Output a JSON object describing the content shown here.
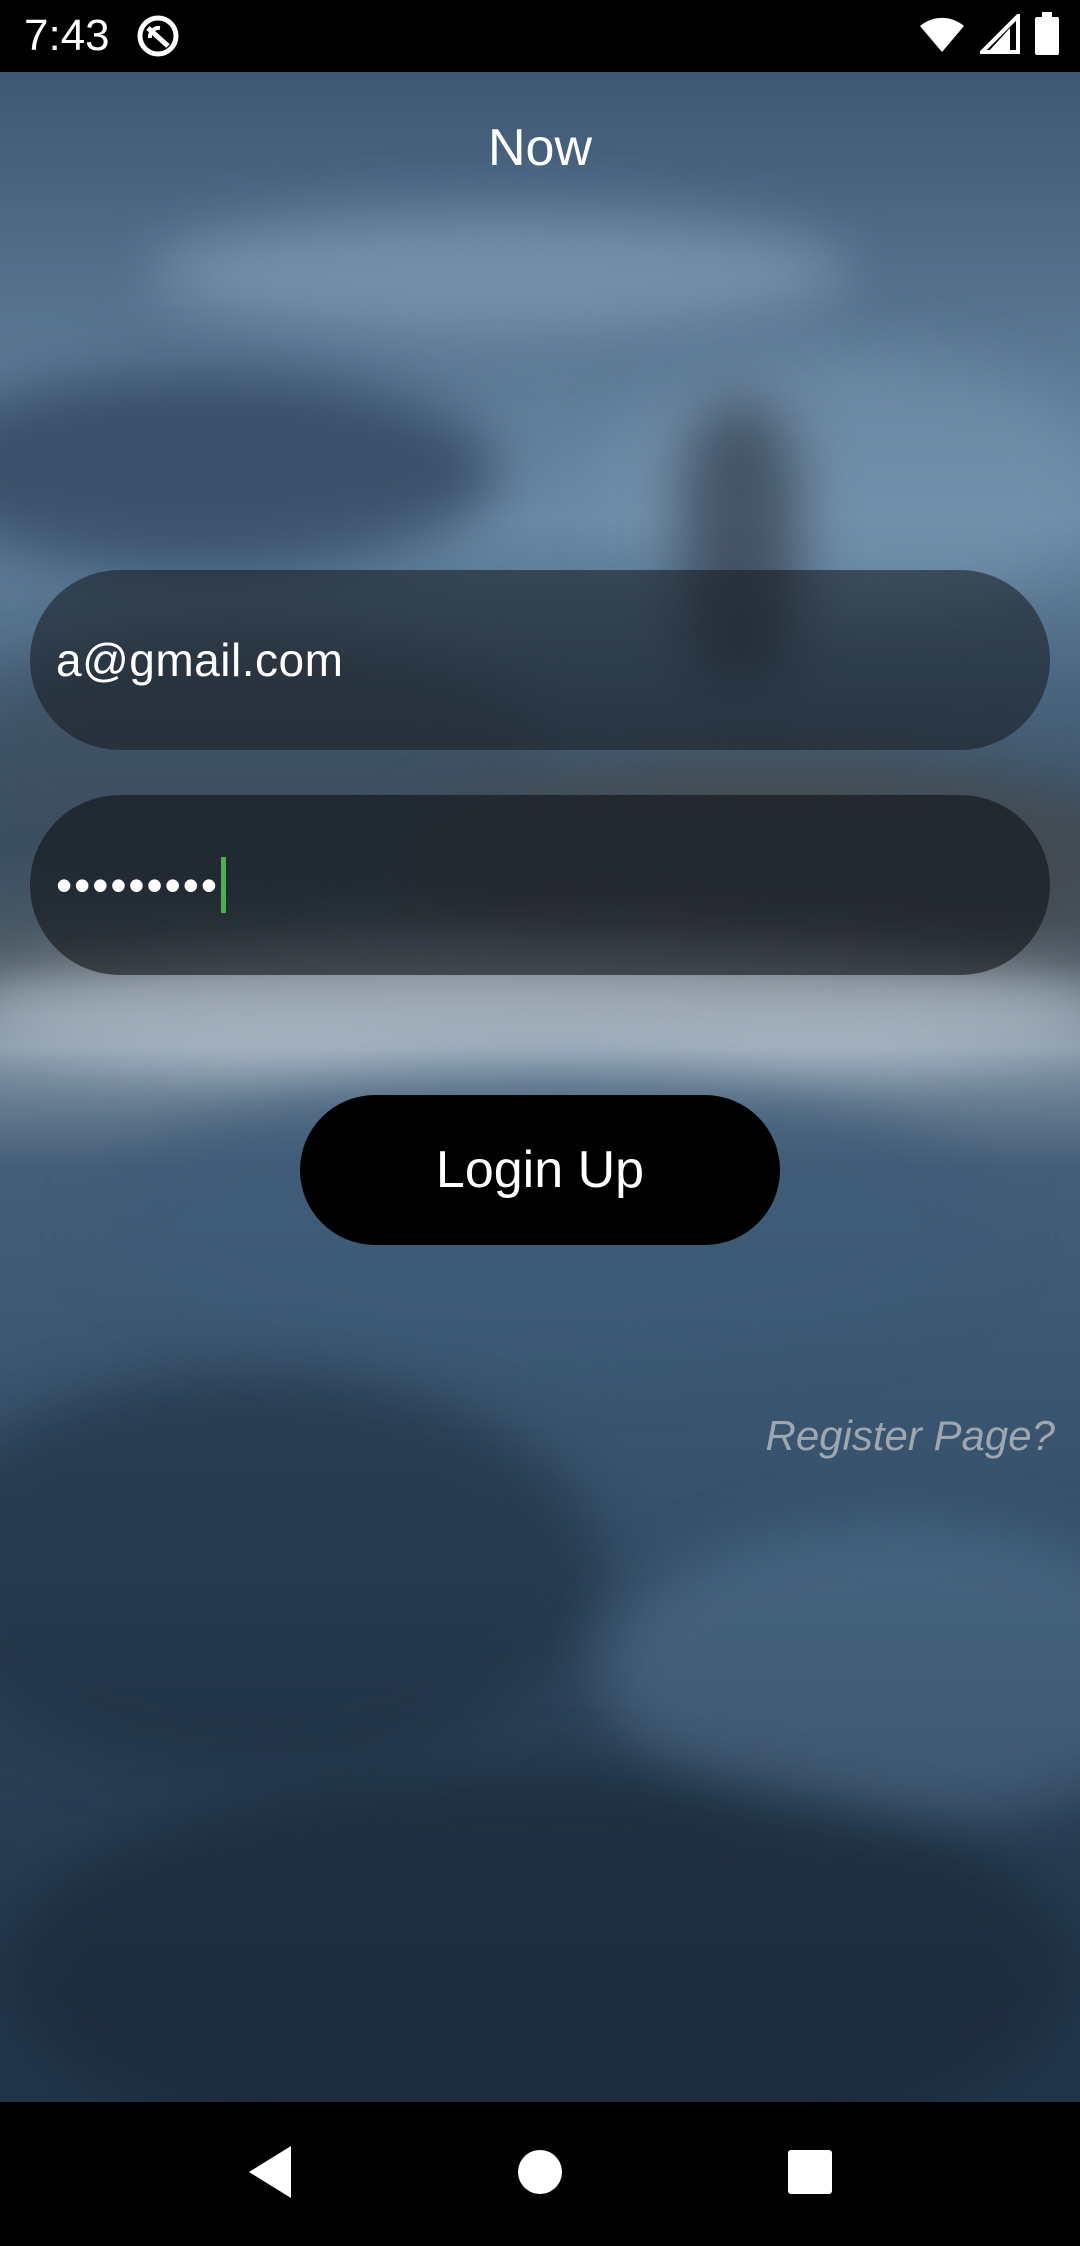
{
  "status_bar": {
    "time": "7:43",
    "app_icon": "app-notification-icon",
    "wifi_icon": "wifi-icon",
    "signal_icon": "signal-icon",
    "battery_icon": "battery-icon"
  },
  "header": {
    "title": "Now"
  },
  "login_form": {
    "email_value": "a@gmail.com",
    "password_value": "•••••••••",
    "login_button_label": "Login Up",
    "register_link_label": "Register Page?"
  },
  "nav_bar": {
    "back_icon": "back-icon",
    "home_icon": "home-icon",
    "recents_icon": "recents-icon"
  },
  "colors": {
    "caret": "#4caf50",
    "register_link": "#9ea6ae",
    "button_bg": "#000000"
  }
}
